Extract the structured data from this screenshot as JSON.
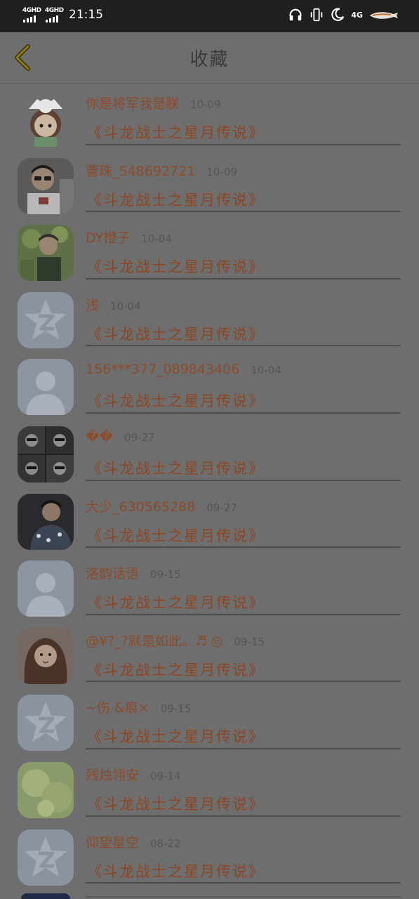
{
  "status_bar": {
    "signal1": "4GHD",
    "signal2": "4GHD",
    "time": "21:15",
    "network": "4G"
  },
  "header": {
    "title": "收藏"
  },
  "favorites": [
    {
      "name": "你是将军我是朕",
      "date": "10-09",
      "story": "《斗龙战士之星月传说》",
      "avatar": "cartoon-girl"
    },
    {
      "name": "曹珠_548692721",
      "date": "10-09",
      "story": "《斗龙战士之星月传说》",
      "avatar": "photo-glasses"
    },
    {
      "name": "DY橙子",
      "date": "10-04",
      "story": "《斗龙战士之星月传说》",
      "avatar": "photo-green"
    },
    {
      "name": "浅",
      "date": "10-04",
      "story": "《斗龙战士之星月传说》",
      "avatar": "qzone-default"
    },
    {
      "name": "156***377_089843406",
      "date": "10-04",
      "story": "《斗龙战士之星月传说》",
      "avatar": "person-default"
    },
    {
      "name": "��",
      "date": "09-27",
      "story": "《斗龙战士之星月传说》",
      "avatar": "photo-grid"
    },
    {
      "name": "大少_630565288",
      "date": "09-27",
      "story": "《斗龙战士之星月传说》",
      "avatar": "photo-dark"
    },
    {
      "name": "洛韵话语",
      "date": "09-15",
      "story": "《斗龙战士之星月传说》",
      "avatar": "person-default"
    },
    {
      "name": "@¥?_?就是如此。♬ ◎",
      "date": "09-15",
      "story": "《斗龙战士之星月传说》",
      "avatar": "photo-girl"
    },
    {
      "name": "~伤 &痕×",
      "date": "09-15",
      "story": "《斗龙战士之星月传说》",
      "avatar": "qzone-default"
    },
    {
      "name": "残烛翎安",
      "date": "09-14",
      "story": "《斗龙战士之星月传说》",
      "avatar": "photo-light"
    },
    {
      "name": "仰望星空",
      "date": "08-22",
      "story": "《斗龙战士之星月传说》",
      "avatar": "qzone-default"
    }
  ],
  "colors": {
    "name": "#8c4b2b",
    "story": "#8e4522",
    "overlay_background": "#6e6e6e"
  }
}
